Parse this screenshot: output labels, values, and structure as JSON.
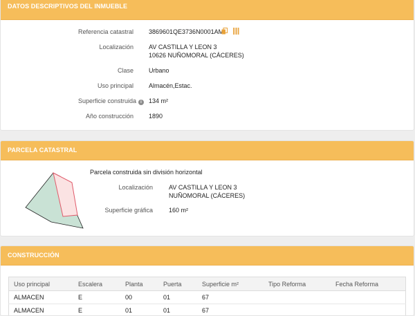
{
  "datos": {
    "header": "DATOS DESCRIPTIVOS DEL INMUEBLE",
    "ref_label": "Referencia catastral",
    "ref_value": "3869601QE3736N0001AM",
    "loc_label": "Localización",
    "loc_line1": "AV CASTILLA Y LEON 3",
    "loc_line2": "10626 NUÑOMORAL (CÁCERES)",
    "clase_label": "Clase",
    "clase_value": "Urbano",
    "uso_label": "Uso principal",
    "uso_value": "Almacén,Estac.",
    "sup_label": "Superficie construida",
    "sup_value": "134 m²",
    "anio_label": "Año construcción",
    "anio_value": "1890",
    "icons": [
      "copy-icon",
      "barcode-icon",
      "info-icon"
    ]
  },
  "parcela": {
    "header": "PARCELA CATASTRAL",
    "desc": "Parcela construida sin división horizontal",
    "loc_label": "Localización",
    "loc_line1": "AV CASTILLA Y LEON 3",
    "loc_line2": "NUÑOMORAL (CÁCERES)",
    "sup_label": "Superficie gráfica",
    "sup_value": "160 m²",
    "map_colors": {
      "parcel_fill": "#c9e2d5",
      "building_fill": "#fbe3e3",
      "building_stroke": "#e05a6a"
    }
  },
  "construccion": {
    "header": "CONSTRUCCIÓN",
    "columns": [
      "Uso principal",
      "Escalera",
      "Planta",
      "Puerta",
      "Superficie m²",
      "Tipo Reforma",
      "Fecha Reforma"
    ],
    "rows": [
      [
        "ALMACEN",
        "E",
        "00",
        "01",
        "67",
        "",
        ""
      ],
      [
        "ALMACEN",
        "E",
        "01",
        "01",
        "67",
        "",
        ""
      ]
    ]
  },
  "colors": {
    "header_bg": "#f6bd5a",
    "accent_icon": "#e8a23a"
  }
}
